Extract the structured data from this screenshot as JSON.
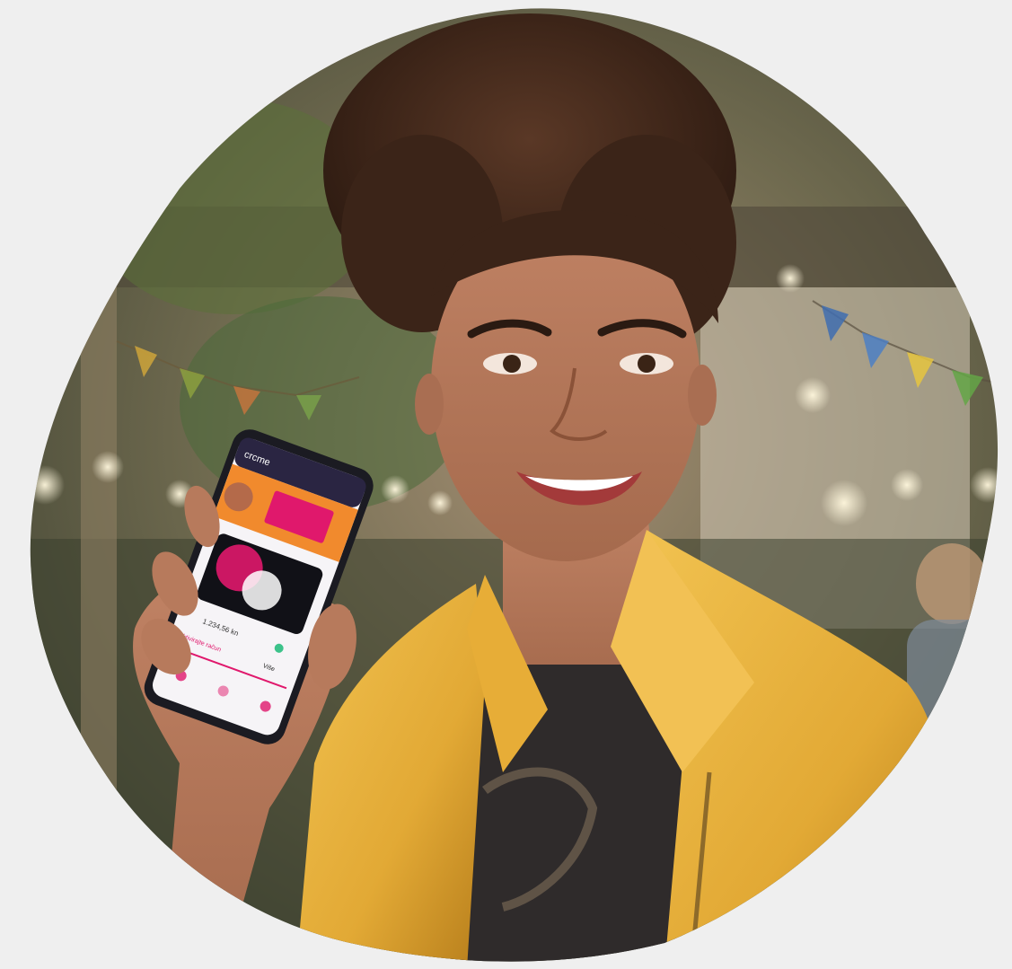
{
  "image": {
    "subject": "photo",
    "background_color": "#efefef"
  },
  "phone_app": {
    "brand_text": "crcme",
    "balance_text": "1.234,56 kn",
    "link_text": "Aktivirajte račun",
    "right_text": "Više"
  },
  "colors": {
    "jacket": "#e8b23a",
    "jacket_shadow": "#c68d1f",
    "shirt": "#2f2b2b",
    "skin": "#b9795a",
    "hair": "#3b2418",
    "app_accent": "#e0186c",
    "phone_frame": "#1b1b22"
  }
}
